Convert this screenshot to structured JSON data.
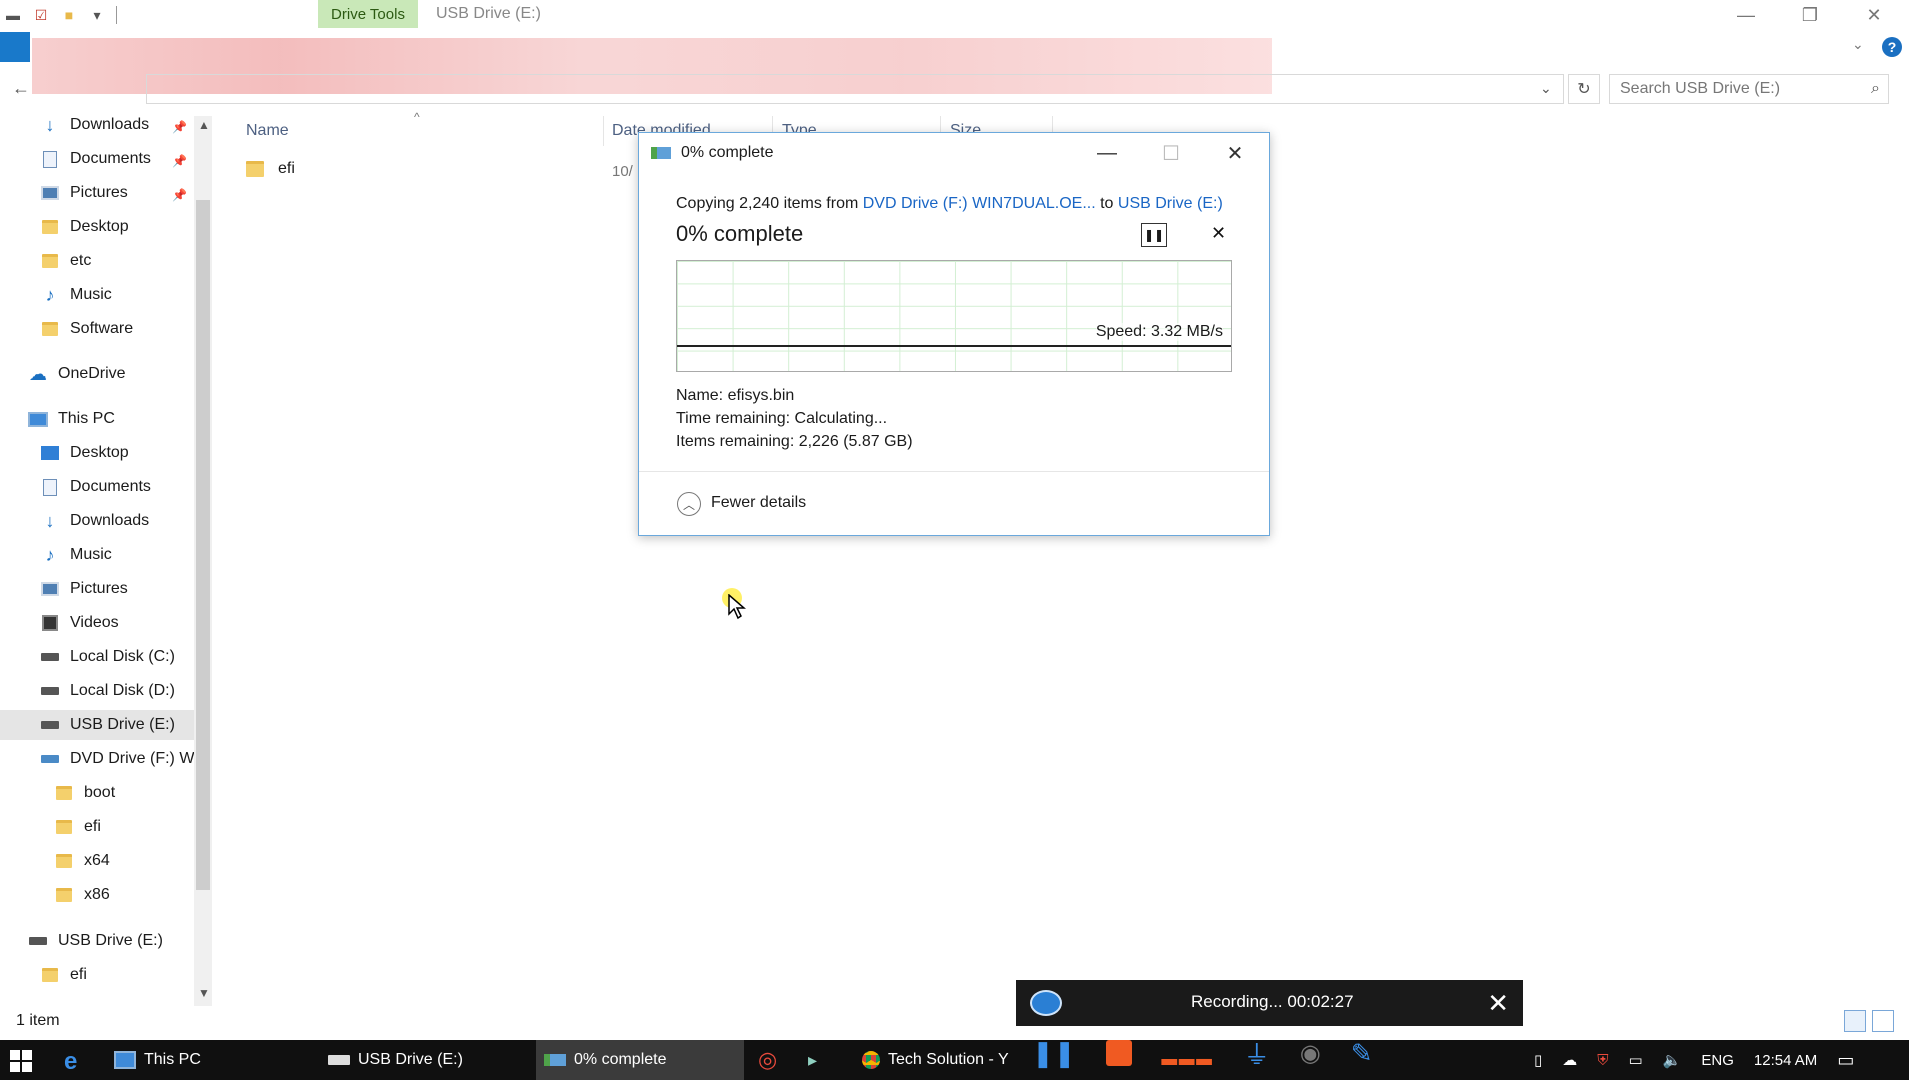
{
  "window": {
    "context_tab": "Drive Tools",
    "title": "USB Drive (E:)",
    "minimize_icon": "minimize-icon",
    "maximize_icon": "restore-icon",
    "close_icon": "close-icon"
  },
  "address": {
    "search_placeholder": "Search USB Drive (E:)"
  },
  "nav": {
    "quick_access": [
      {
        "label": "Downloads",
        "icon": "download-arrow-icon",
        "pinned": true
      },
      {
        "label": "Documents",
        "icon": "documents-icon",
        "pinned": true
      },
      {
        "label": "Pictures",
        "icon": "pictures-icon",
        "pinned": true
      },
      {
        "label": "Desktop",
        "icon": "folder-icon"
      },
      {
        "label": "etc",
        "icon": "folder-icon"
      },
      {
        "label": "Music",
        "icon": "music-icon"
      },
      {
        "label": "Software",
        "icon": "folder-icon"
      }
    ],
    "onedrive": "OneDrive",
    "this_pc": "This PC",
    "this_pc_items": [
      {
        "label": "Desktop",
        "icon": "desktop-icon"
      },
      {
        "label": "Documents",
        "icon": "documents-icon"
      },
      {
        "label": "Downloads",
        "icon": "download-arrow-icon"
      },
      {
        "label": "Music",
        "icon": "music-icon"
      },
      {
        "label": "Pictures",
        "icon": "pictures-icon"
      },
      {
        "label": "Videos",
        "icon": "videos-icon"
      },
      {
        "label": "Local Disk (C:)",
        "icon": "drive-icon"
      },
      {
        "label": "Local Disk (D:)",
        "icon": "drive-icon"
      },
      {
        "label": "USB Drive (E:)",
        "icon": "usb-drive-icon",
        "selected": true
      },
      {
        "label": "DVD Drive (F:) W",
        "icon": "dvd-drive-icon"
      }
    ],
    "dvd_children": [
      "boot",
      "efi",
      "x64",
      "x86"
    ],
    "usb_root": "USB Drive (E:)",
    "usb_children": [
      "efi"
    ]
  },
  "file_list": {
    "columns": [
      "Name",
      "Date modified",
      "Type",
      "Size"
    ],
    "rows": [
      {
        "name": "efi",
        "date": "10/"
      }
    ]
  },
  "copy_dialog": {
    "title": "0% complete",
    "copy_prefix": "Copying 2,240 items from ",
    "source": "DVD Drive (F:) WIN7DUAL.OE...",
    "to_word": " to ",
    "destination": "USB Drive (E:)",
    "percent": "0% complete",
    "progress": 0,
    "speed": "Speed: 3.32 MB/s",
    "name_line": "Name:  efisys.bin",
    "time_line": "Time remaining:  Calculating...",
    "items_line": "Items remaining:  2,226 (5.87 GB)",
    "fewer_details": "Fewer details"
  },
  "status_bar": {
    "item_count": "1 item"
  },
  "recording": {
    "text": "Recording... 00:02:27"
  },
  "taskbar": {
    "items": [
      {
        "label": "This PC",
        "icon": "this-pc-icon"
      },
      {
        "label": "USB Drive (E:)",
        "icon": "usb-drive-icon"
      },
      {
        "label": "0% complete",
        "icon": "copy-progress-icon",
        "active": true
      },
      {
        "label": "Tech Solution - Y",
        "icon": "chrome-icon"
      }
    ],
    "tray": {
      "language": "ENG",
      "time": "12:54 AM"
    }
  }
}
